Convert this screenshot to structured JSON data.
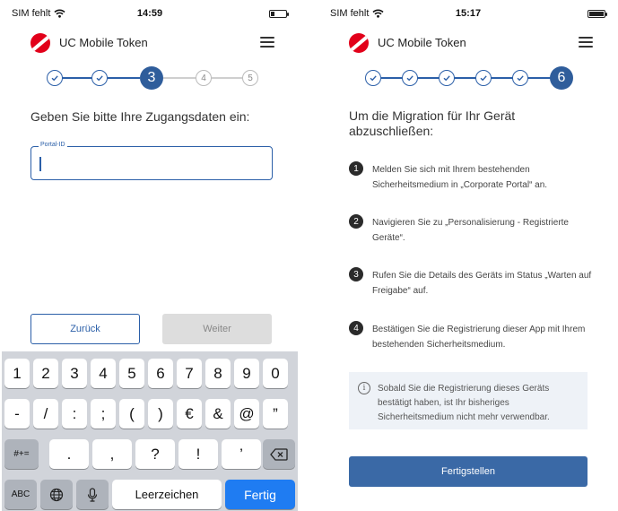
{
  "left": {
    "status": {
      "carrier": "SIM fehlt",
      "time": "14:59",
      "battery_level": 0.25
    },
    "header": {
      "title": "UC Mobile Token"
    },
    "stepper": {
      "current": "3",
      "upcoming": [
        "4",
        "5"
      ]
    },
    "prompt": "Geben Sie bitte Ihre Zugangsdaten ein:",
    "field": {
      "label": "Portal-ID",
      "value": ""
    },
    "buttons": {
      "back": "Zurück",
      "next": "Weiter"
    },
    "keyboard": {
      "row1": [
        "1",
        "2",
        "3",
        "4",
        "5",
        "6",
        "7",
        "8",
        "9",
        "0"
      ],
      "row2": [
        "-",
        "/",
        ":",
        ";",
        "(",
        ")",
        "€",
        "&",
        "@",
        "”"
      ],
      "row3_mode": "#+=",
      "row3": [
        ".",
        ",",
        "?",
        "!",
        "’"
      ],
      "abc": "ABC",
      "space": "Leerzeichen",
      "done": "Fertig"
    }
  },
  "right": {
    "status": {
      "carrier": "SIM fehlt",
      "time": "15:17",
      "battery_level": 1.0
    },
    "header": {
      "title": "UC Mobile Token"
    },
    "stepper": {
      "current": "6"
    },
    "heading": "Um die Migration für Ihr Gerät abzuschließen:",
    "instructions": [
      {
        "num": "1",
        "text": "Melden Sie sich mit Ihrem bestehenden Sicherheitsmedium in „Corporate Portal“ an."
      },
      {
        "num": "2",
        "text": "Navigieren Sie zu „Personalisierung - Registrierte Geräte“."
      },
      {
        "num": "3",
        "text": "Rufen Sie die Details des Geräts im Status „Warten auf Freigabe“ auf."
      },
      {
        "num": "4",
        "text": "Bestätigen Sie die Registrierung dieser App mit Ihrem bestehenden Sicherheitsmedium."
      }
    ],
    "info": "Sobald Sie die Registrierung dieses Geräts bestätigt haben, ist Ihr bisheriges Sicherheitsmedium nicht mehr verwendbar.",
    "button": "Fertigstellen"
  },
  "icons": {
    "wifi": "wifi-icon",
    "battery": "battery-icon",
    "logo": "unicredit-logo-icon",
    "menu": "hamburger-menu-icon",
    "check": "checkmark-icon",
    "info": "info-icon",
    "globe": "globe-icon",
    "mic": "microphone-icon",
    "backspace": "backspace-icon"
  },
  "colors": {
    "accent": "#2f5d9b",
    "brand_red": "#e2001a",
    "keyboard_go": "#1f7cf2"
  }
}
